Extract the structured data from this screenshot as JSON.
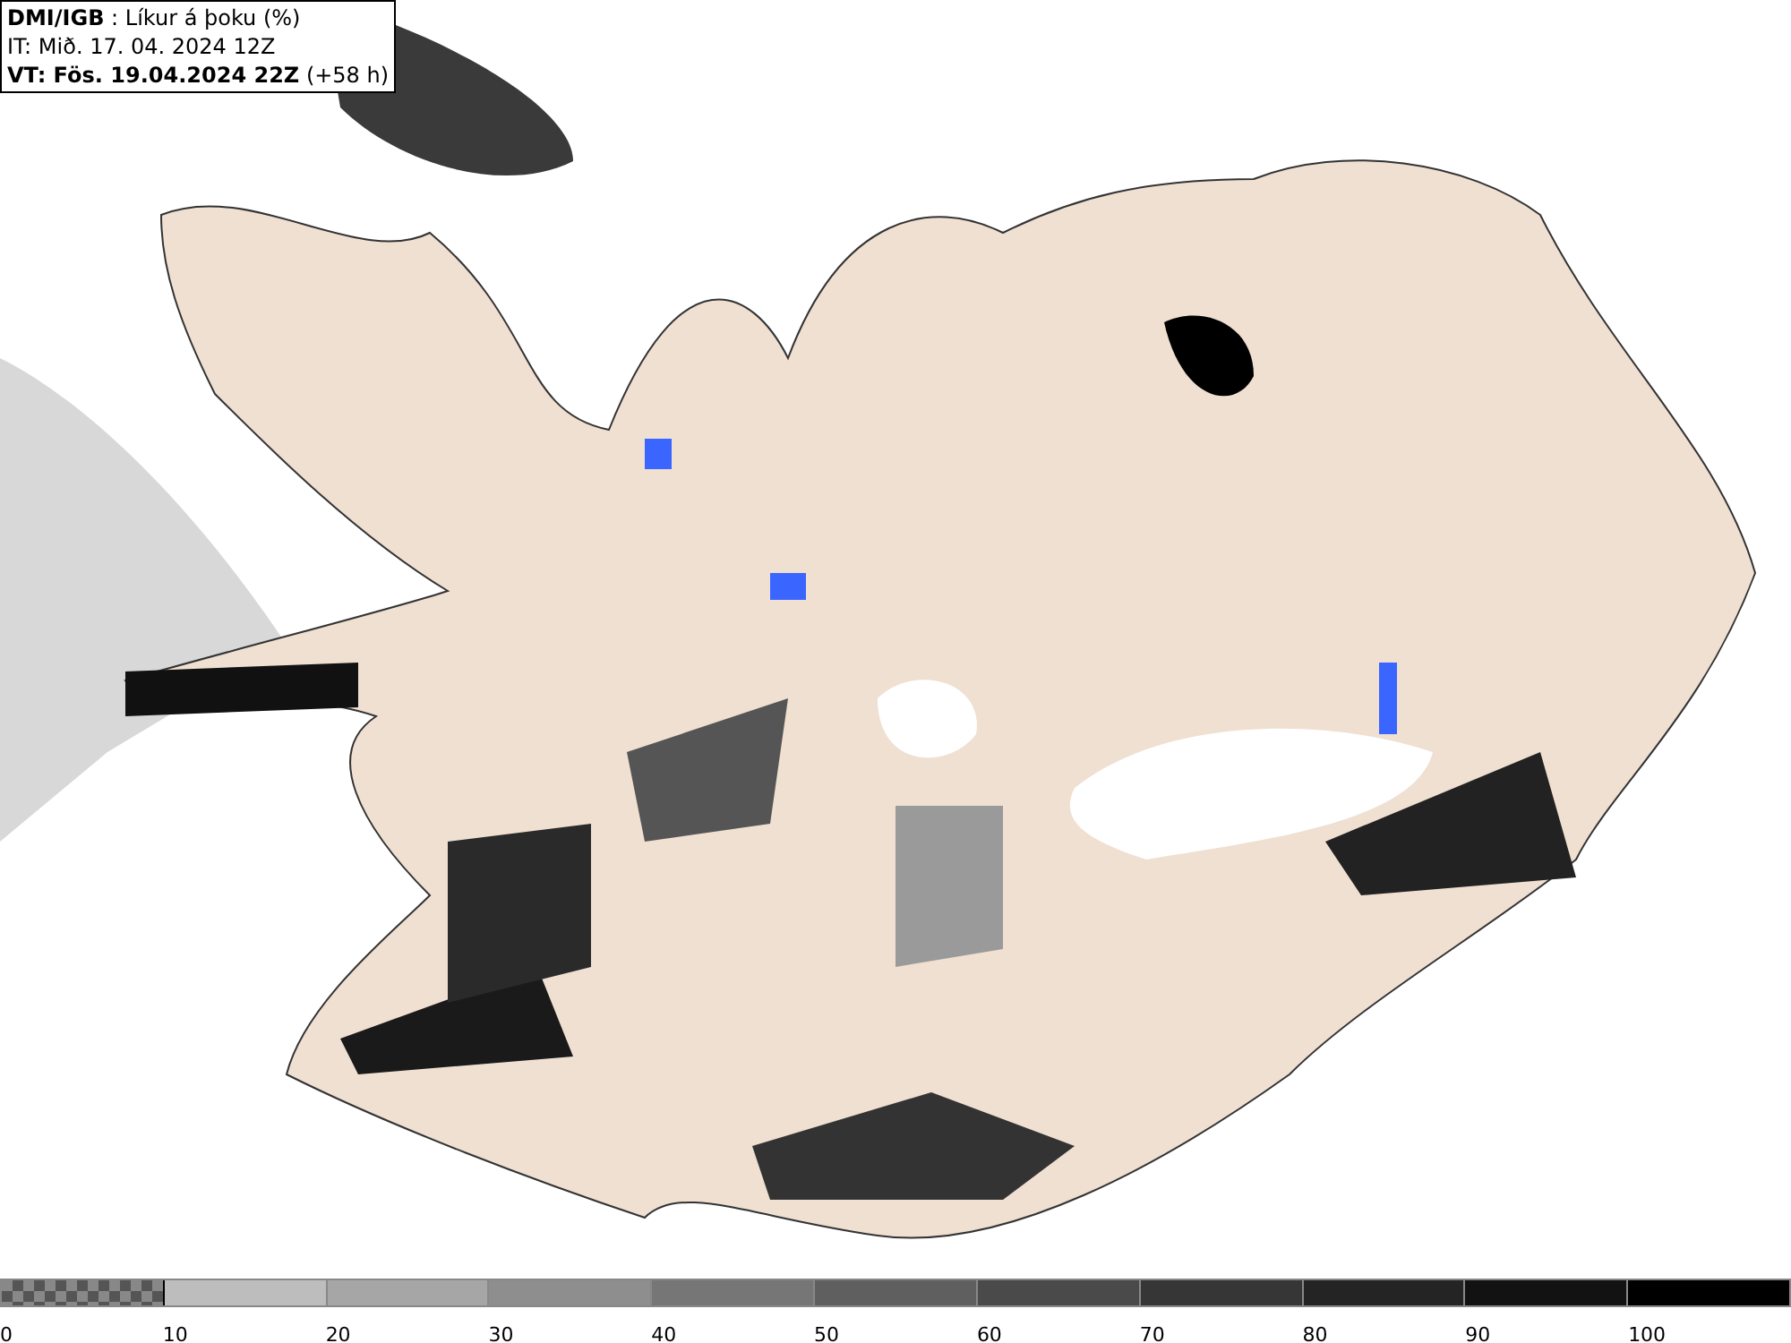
{
  "header": {
    "lines": [
      "**DMI/IGB** : Líkur á þoku (%)",
      "IT: Mið. 17. 04. 2024 12Z",
      "**VT: Fös. 19.04.2024 22Z** (+58 h)"
    ]
  },
  "legend": {
    "segments": [
      {
        "kind": "pattern"
      },
      {
        "kind": "solid",
        "color": "#bdbdbd"
      },
      {
        "kind": "solid",
        "color": "#a6a6a6"
      },
      {
        "kind": "solid",
        "color": "#8e8e8e"
      },
      {
        "kind": "solid",
        "color": "#767676"
      },
      {
        "kind": "solid",
        "color": "#5f5f5f"
      },
      {
        "kind": "solid",
        "color": "#4a4a4a"
      },
      {
        "kind": "solid",
        "color": "#363636"
      },
      {
        "kind": "solid",
        "color": "#242424"
      },
      {
        "kind": "solid",
        "color": "#121212"
      },
      {
        "kind": "solid",
        "color": "#000000"
      }
    ],
    "labels": [
      "0",
      "10",
      "20",
      "30",
      "40",
      "50",
      "60",
      "70",
      "80",
      "90",
      "100"
    ]
  }
}
